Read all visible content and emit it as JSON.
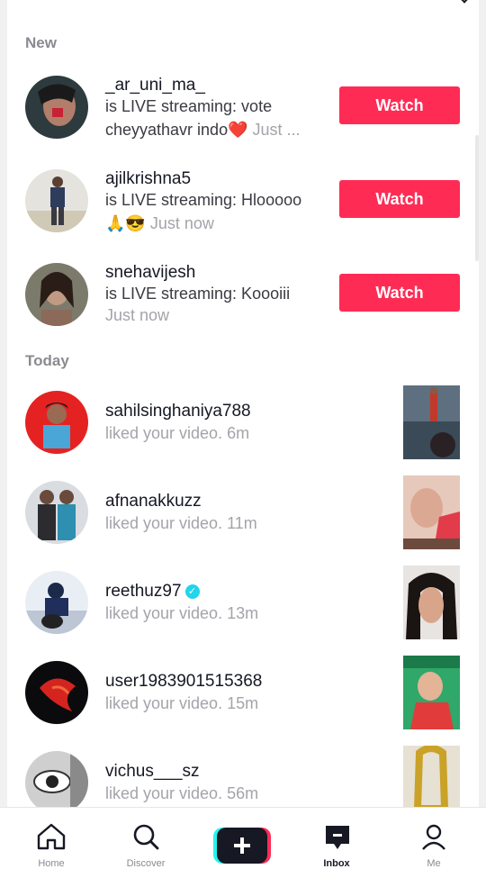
{
  "sections": {
    "new": "New",
    "today": "Today"
  },
  "live": [
    {
      "username": "_ar_uni_ma_",
      "line1": "is LIVE streaming: vote",
      "line2_text": "cheyyathavr indo",
      "line2_emoji": "❤️",
      "line2_time": "Just ...",
      "button": "Watch"
    },
    {
      "username": "ajilkrishna5",
      "line1": "is LIVE streaming: Hlooooo",
      "line2_emoji": "🙏😎",
      "line2_time": "Just now",
      "button": "Watch"
    },
    {
      "username": "snehavijesh",
      "line1": "is LIVE streaming: Koooiii",
      "line2_time": "Just now",
      "button": "Watch"
    }
  ],
  "activity": [
    {
      "username": "sahilsinghaniya788",
      "action": "liked your video.",
      "time": "6m"
    },
    {
      "username": "afnanakkuzz",
      "action": "liked your video.",
      "time": "11m"
    },
    {
      "username": "reethuz97",
      "verified": "✓",
      "action": "liked your video.",
      "time": "13m"
    },
    {
      "username": "user1983901515368",
      "action": "liked your video.",
      "time": "15m"
    },
    {
      "username": "vichus___sz",
      "action": "liked your video.",
      "time": "56m"
    }
  ],
  "nav": [
    {
      "label": "Home",
      "icon": "home-icon"
    },
    {
      "label": "Discover",
      "icon": "search-icon"
    },
    {
      "label": "",
      "icon": "plus-icon"
    },
    {
      "label": "Inbox",
      "icon": "inbox-icon"
    },
    {
      "label": "Me",
      "icon": "profile-icon"
    }
  ],
  "colors": {
    "accent": "#fe2c55",
    "cyan": "#25f4ee",
    "secondary_text": "#a3a4aa"
  }
}
